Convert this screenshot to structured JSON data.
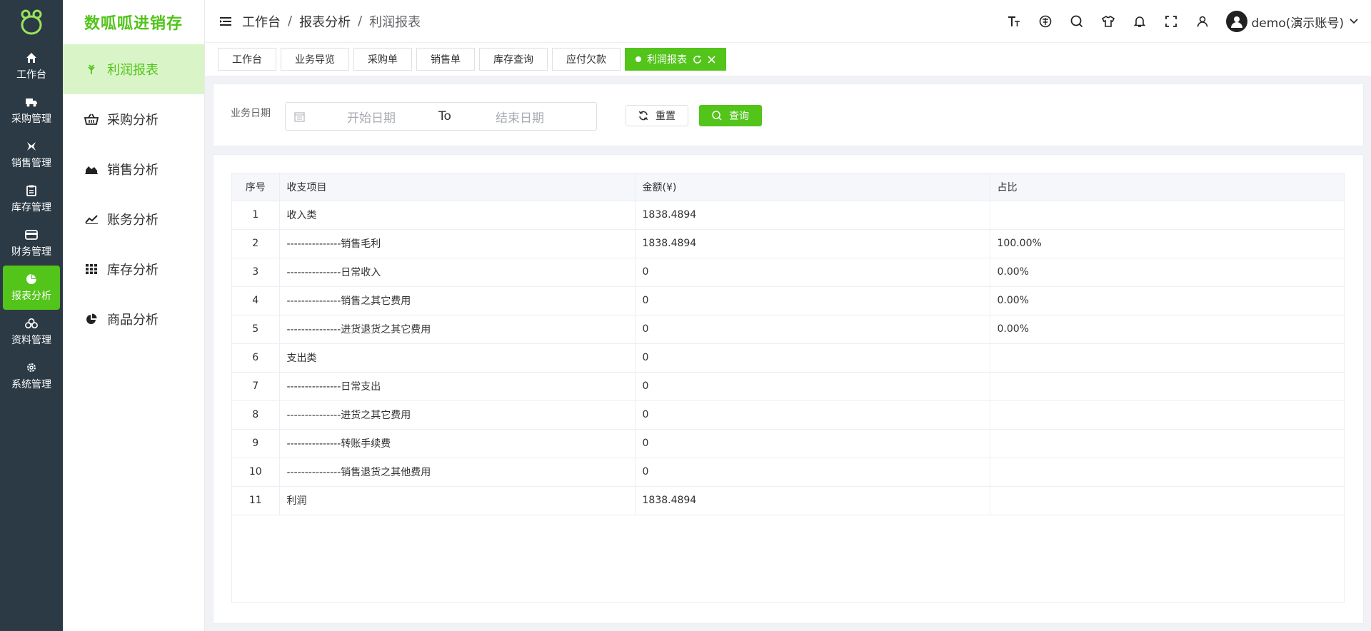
{
  "brand": {
    "name": "数呱呱进销存",
    "accent": "#52c41a"
  },
  "rail": {
    "items": [
      {
        "label": "工作台",
        "icon": "home-icon"
      },
      {
        "label": "采购管理",
        "icon": "truck-icon"
      },
      {
        "label": "销售管理",
        "icon": "sales-icon"
      },
      {
        "label": "库存管理",
        "icon": "clipboard-icon"
      },
      {
        "label": "财务管理",
        "icon": "card-icon"
      },
      {
        "label": "报表分析",
        "icon": "pie-icon",
        "active": true
      },
      {
        "label": "资料管理",
        "icon": "boxes-icon"
      },
      {
        "label": "系统管理",
        "icon": "gear-icon"
      }
    ]
  },
  "subnav": {
    "items": [
      {
        "label": "利润报表",
        "icon": "leaf-icon",
        "active": true
      },
      {
        "label": "采购分析",
        "icon": "basket-icon"
      },
      {
        "label": "销售分析",
        "icon": "area-chart-icon"
      },
      {
        "label": "账务分析",
        "icon": "line-chart-icon"
      },
      {
        "label": "库存分析",
        "icon": "grid-icon"
      },
      {
        "label": "商品分析",
        "icon": "pie-chart-icon"
      }
    ]
  },
  "header": {
    "breadcrumb": [
      "工作台",
      "报表分析",
      "利润报表"
    ],
    "user": "demo(演示账号)"
  },
  "tags": [
    "工作台",
    "业务导览",
    "采购单",
    "销售单",
    "库存查询",
    "应付欠款"
  ],
  "active_tag": "利润报表",
  "filter": {
    "label": "业务日期",
    "start_placeholder": "开始日期",
    "to": "To",
    "end_placeholder": "结束日期",
    "reset": "重置",
    "query": "查询"
  },
  "table": {
    "columns": [
      "序号",
      "收支项目",
      "金额(¥)",
      "占比"
    ],
    "rows": [
      [
        "1",
        "收入类",
        "1838.4894",
        ""
      ],
      [
        "2",
        "---------------销售毛利",
        "1838.4894",
        "100.00%"
      ],
      [
        "3",
        "---------------日常收入",
        "0",
        "0.00%"
      ],
      [
        "4",
        "---------------销售之其它费用",
        "0",
        "0.00%"
      ],
      [
        "5",
        "---------------进货退货之其它费用",
        "0",
        "0.00%"
      ],
      [
        "6",
        "支出类",
        "0",
        ""
      ],
      [
        "7",
        "---------------日常支出",
        "0",
        ""
      ],
      [
        "8",
        "---------------进货之其它费用",
        "0",
        ""
      ],
      [
        "9",
        "---------------转账手续费",
        "0",
        ""
      ],
      [
        "10",
        "---------------销售退货之其他费用",
        "0",
        ""
      ],
      [
        "11",
        "利润",
        "1838.4894",
        ""
      ]
    ]
  }
}
